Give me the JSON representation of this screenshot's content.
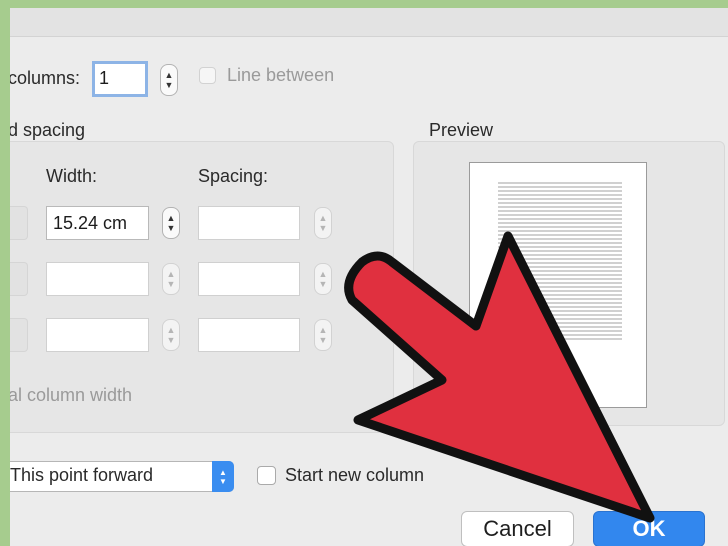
{
  "dialog": {
    "number_of_columns_label": "columns:",
    "number_of_columns_value": "1",
    "line_between_label": "Line between",
    "width_spacing_heading": "d spacing",
    "width_header": "Width:",
    "spacing_header": "Spacing:",
    "width_row1_value": "15.24 cm",
    "equal_column_width_label": "al column width",
    "apply_to_value": "This point forward",
    "start_new_column_label": "Start new column",
    "preview_heading": "Preview",
    "cancel_label": "Cancel",
    "ok_label": "OK"
  },
  "colors": {
    "background": "#a6cc8e",
    "arrow_fill": "#e0303f",
    "ok_button": "#3287ee"
  }
}
